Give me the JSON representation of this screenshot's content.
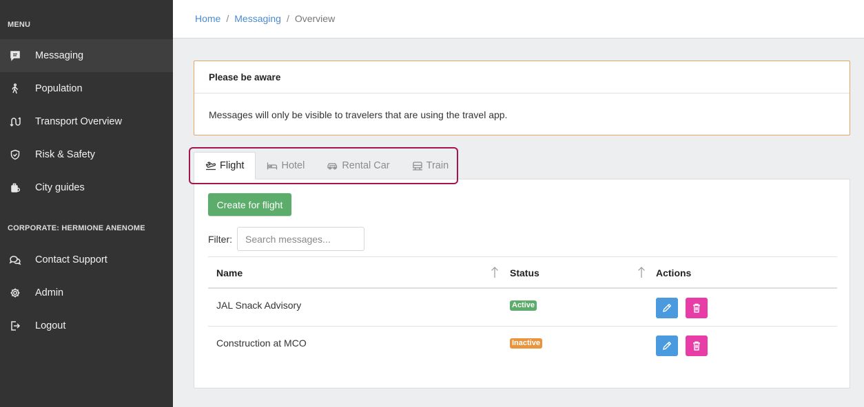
{
  "sidebar": {
    "menu_title": "MENU",
    "items": [
      {
        "label": "Messaging",
        "icon": "message-icon"
      },
      {
        "label": "Population",
        "icon": "walking-icon"
      },
      {
        "label": "Transport Overview",
        "icon": "route-icon"
      },
      {
        "label": "Risk & Safety",
        "icon": "shield-icon"
      },
      {
        "label": "City guides",
        "icon": "luggage-icon"
      }
    ],
    "corporate_title": "CORPORATE: HERMIONE ANENOME",
    "corporate_items": [
      {
        "label": "Contact Support",
        "icon": "chat-bubbles-icon"
      },
      {
        "label": "Admin",
        "icon": "gear-icon"
      },
      {
        "label": "Logout",
        "icon": "logout-icon"
      }
    ]
  },
  "breadcrumb": {
    "items": [
      "Home",
      "Messaging"
    ],
    "separator": "/",
    "current": "Overview"
  },
  "alert": {
    "title": "Please be aware",
    "body": "Messages will only be visible to travelers that are using the travel app."
  },
  "tabs": [
    {
      "label": "Flight",
      "icon": "plane-icon",
      "active": true
    },
    {
      "label": "Hotel",
      "icon": "bed-icon",
      "active": false
    },
    {
      "label": "Rental Car",
      "icon": "car-icon",
      "active": false
    },
    {
      "label": "Train",
      "icon": "train-icon",
      "active": false
    }
  ],
  "panel": {
    "create_button": "Create for flight",
    "filter_label": "Filter:",
    "filter_placeholder": "Search messages...",
    "columns": [
      "Name",
      "Status",
      "Actions"
    ],
    "rows": [
      {
        "name": "JAL Snack Advisory",
        "status": "Active"
      },
      {
        "name": "Construction at MCO",
        "status": "Inactive"
      }
    ]
  },
  "colors": {
    "sidebar_bg": "#333333",
    "link": "#4a8bd1",
    "alert_border": "#e8a366",
    "tab_highlight": "#a3154f",
    "create_button": "#5cad6b",
    "status_active": "#5cad6b",
    "status_inactive": "#e8953e",
    "edit_button": "#4a9ae0",
    "delete_button": "#e83ca7"
  }
}
